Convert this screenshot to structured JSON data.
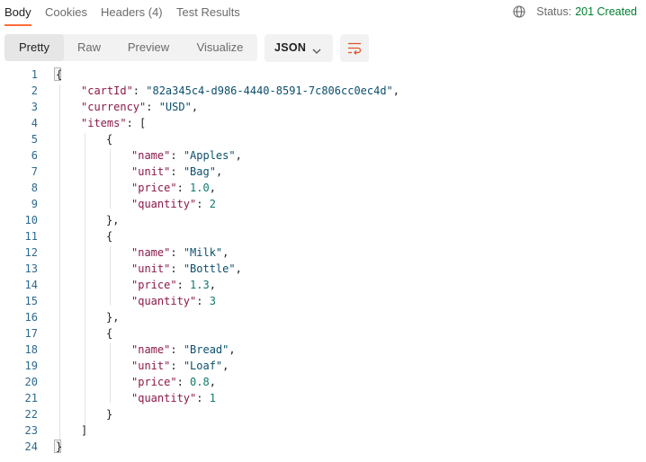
{
  "tabs": [
    {
      "label": "Body",
      "active": true
    },
    {
      "label": "Cookies",
      "active": false
    },
    {
      "label": "Headers (4)",
      "active": false
    },
    {
      "label": "Test Results",
      "active": false
    }
  ],
  "status": {
    "label": "Status:",
    "value": "201 Created",
    "color": "#007f31"
  },
  "view_modes": [
    "Pretty",
    "Raw",
    "Preview",
    "Visualize"
  ],
  "active_view_mode": "Pretty",
  "format": {
    "selected": "JSON"
  },
  "icons": {
    "globe": "globe-icon",
    "format_chevron": "chevron-down-icon",
    "wrap": "wrap-lines-icon"
  },
  "colors": {
    "accent": "#ff6c37",
    "key": "#8a1a4a",
    "string": "#0b4f6c",
    "number": "#0f7a6e",
    "line_number": "#2d6a8e"
  },
  "line_numbers": [
    "1",
    "2",
    "3",
    "4",
    "5",
    "6",
    "7",
    "8",
    "9",
    "10",
    "11",
    "12",
    "13",
    "14",
    "15",
    "16",
    "17",
    "18",
    "19",
    "20",
    "21",
    "22",
    "23",
    "24"
  ],
  "code_lines": [
    [
      {
        "t": "p",
        "v": "{"
      }
    ],
    [
      {
        "t": "k",
        "v": "\"cartId\""
      },
      {
        "t": "p",
        "v": ": "
      },
      {
        "t": "s",
        "v": "\"82a345c4-d986-4440-8591-7c806cc0ec4d\""
      },
      {
        "t": "p",
        "v": ","
      }
    ],
    [
      {
        "t": "k",
        "v": "\"currency\""
      },
      {
        "t": "p",
        "v": ": "
      },
      {
        "t": "s",
        "v": "\"USD\""
      },
      {
        "t": "p",
        "v": ","
      }
    ],
    [
      {
        "t": "k",
        "v": "\"items\""
      },
      {
        "t": "p",
        "v": ": ["
      }
    ],
    [
      {
        "t": "p",
        "v": "{"
      }
    ],
    [
      {
        "t": "k",
        "v": "\"name\""
      },
      {
        "t": "p",
        "v": ": "
      },
      {
        "t": "s",
        "v": "\"Apples\""
      },
      {
        "t": "p",
        "v": ","
      }
    ],
    [
      {
        "t": "k",
        "v": "\"unit\""
      },
      {
        "t": "p",
        "v": ": "
      },
      {
        "t": "s",
        "v": "\"Bag\""
      },
      {
        "t": "p",
        "v": ","
      }
    ],
    [
      {
        "t": "k",
        "v": "\"price\""
      },
      {
        "t": "p",
        "v": ": "
      },
      {
        "t": "n",
        "v": "1.0"
      },
      {
        "t": "p",
        "v": ","
      }
    ],
    [
      {
        "t": "k",
        "v": "\"quantity\""
      },
      {
        "t": "p",
        "v": ": "
      },
      {
        "t": "n",
        "v": "2"
      }
    ],
    [
      {
        "t": "p",
        "v": "},"
      }
    ],
    [
      {
        "t": "p",
        "v": "{"
      }
    ],
    [
      {
        "t": "k",
        "v": "\"name\""
      },
      {
        "t": "p",
        "v": ": "
      },
      {
        "t": "s",
        "v": "\"Milk\""
      },
      {
        "t": "p",
        "v": ","
      }
    ],
    [
      {
        "t": "k",
        "v": "\"unit\""
      },
      {
        "t": "p",
        "v": ": "
      },
      {
        "t": "s",
        "v": "\"Bottle\""
      },
      {
        "t": "p",
        "v": ","
      }
    ],
    [
      {
        "t": "k",
        "v": "\"price\""
      },
      {
        "t": "p",
        "v": ": "
      },
      {
        "t": "n",
        "v": "1.3"
      },
      {
        "t": "p",
        "v": ","
      }
    ],
    [
      {
        "t": "k",
        "v": "\"quantity\""
      },
      {
        "t": "p",
        "v": ": "
      },
      {
        "t": "n",
        "v": "3"
      }
    ],
    [
      {
        "t": "p",
        "v": "},"
      }
    ],
    [
      {
        "t": "p",
        "v": "{"
      }
    ],
    [
      {
        "t": "k",
        "v": "\"name\""
      },
      {
        "t": "p",
        "v": ": "
      },
      {
        "t": "s",
        "v": "\"Bread\""
      },
      {
        "t": "p",
        "v": ","
      }
    ],
    [
      {
        "t": "k",
        "v": "\"unit\""
      },
      {
        "t": "p",
        "v": ": "
      },
      {
        "t": "s",
        "v": "\"Loaf\""
      },
      {
        "t": "p",
        "v": ","
      }
    ],
    [
      {
        "t": "k",
        "v": "\"price\""
      },
      {
        "t": "p",
        "v": ": "
      },
      {
        "t": "n",
        "v": "0.8"
      },
      {
        "t": "p",
        "v": ","
      }
    ],
    [
      {
        "t": "k",
        "v": "\"quantity\""
      },
      {
        "t": "p",
        "v": ": "
      },
      {
        "t": "n",
        "v": "1"
      }
    ],
    [
      {
        "t": "p",
        "v": "}"
      }
    ],
    [
      {
        "t": "p",
        "v": "]"
      }
    ],
    [
      {
        "t": "p",
        "v": "}"
      }
    ]
  ]
}
